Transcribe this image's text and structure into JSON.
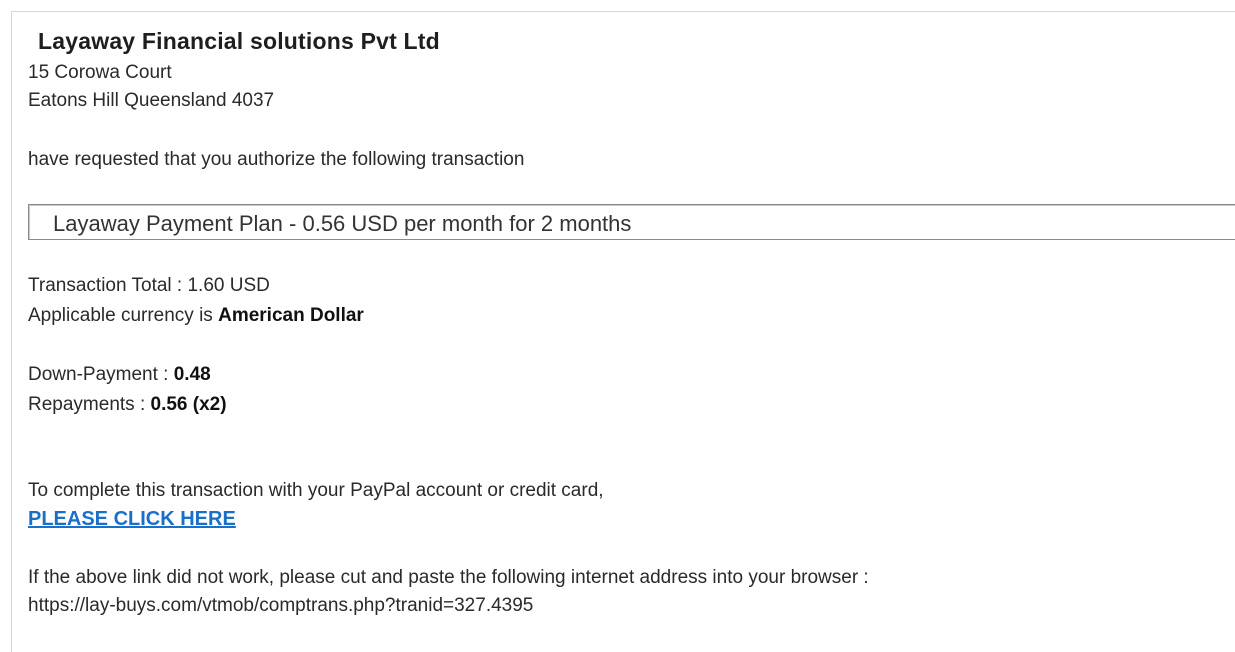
{
  "company": {
    "name": "Layaway Financial solutions Pvt Ltd",
    "address_line1": "15 Corowa Court",
    "address_line2": "Eatons Hill Queensland 4037"
  },
  "request_text": "have requested that you authorize the following transaction",
  "plan": {
    "label": "Layaway Payment Plan",
    "separator": " - ",
    "detail": "0.56 USD per month for 2 months"
  },
  "totals": {
    "total_label": "Transaction Total : ",
    "total_value": "1.60 USD",
    "currency_label": "Applicable currency is ",
    "currency_value": "American Dollar"
  },
  "payments": {
    "down_label": "Down-Payment : ",
    "down_value": "0.48",
    "repay_label": "Repayments : ",
    "repay_value": "0.56 (x2)"
  },
  "complete_text": "To complete this transaction with your PayPal account or credit card,",
  "link_text": "PLEASE CLICK HERE",
  "fallback_text": "If the above link did not work, please cut and paste the following internet address into your browser :",
  "fallback_url": "https://lay-buys.com/vtmob/comptrans.php?tranid=327.4395",
  "colors": {
    "link": "#1a6fc9",
    "text": "#2a2a2a",
    "border": "#8a8a8a"
  }
}
